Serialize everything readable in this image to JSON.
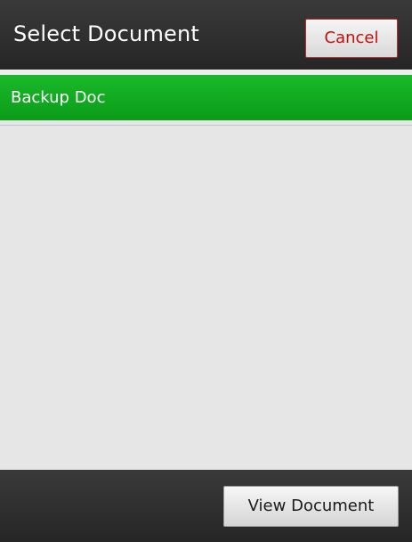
{
  "header": {
    "title": "Select Document",
    "cancel_label": "Cancel"
  },
  "list": {
    "items": [
      {
        "label": "Backup Doc",
        "selected": true
      }
    ]
  },
  "footer": {
    "view_label": "View Document"
  },
  "colors": {
    "bar_background": "#2e2e2e",
    "list_background": "#e6e6e6",
    "selected_item": "#13ab22",
    "cancel_text": "#c10e0e",
    "cancel_border": "#b73030"
  }
}
